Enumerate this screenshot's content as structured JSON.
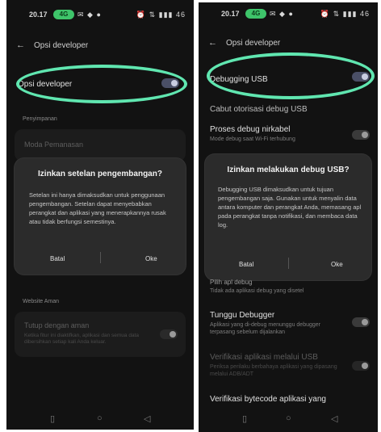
{
  "left": {
    "status": {
      "time": "20.17",
      "pill": "4G",
      "icons": "✉ ◆ ●",
      "sys": "⏰ ⇅ ▮▮▮ 46"
    },
    "appbar_title": "Opsi developer",
    "developer_option": "Opsi developer",
    "section_title": "Penyimpanan",
    "faded_row": "Moda Pemanasan",
    "dialog": {
      "title": "Izinkan setelan pengembangan?",
      "body": "Setelan ini hanya dimaksudkan untuk penggunaan pengembangan. Setelan dapat menyebabkan perangkat dan aplikasi yang menerapkannya rusak atau tidak berfungsi semestinya.",
      "cancel": "Batal",
      "ok": "Oke"
    },
    "lower_section": "Website Aman",
    "lower_row": {
      "label": "Tutup dengan aman",
      "sub": "Ketika fitur ini diaktifkan, aplikasi dan semua data dibersihkan setiap kali Anda keluar."
    },
    "nav": {
      "recent": "▯",
      "home": "○",
      "back": "◁"
    }
  },
  "right": {
    "status": {
      "time": "20.17",
      "pill": "4G",
      "icons": "✉ ◆ ●",
      "sys": "⏰ ⇅ ▮▮▮ 46"
    },
    "appbar_title": "Opsi developer",
    "usb_debugging": "Debugging USB",
    "row_revoke": "Cabut otorisasi debug USB",
    "row_wireless": {
      "label": "Proses debug nirkabel",
      "sub": "Mode debug saat Wi-Fi terhubung"
    },
    "dialog": {
      "title": "Izinkan melakukan debug USB?",
      "body": "Debugging USB dimaksudkan untuk tujuan pengembangan saja. Gunakan untuk menyalin data antara komputer dan perangkat Anda, memasang apl pada perangkat tanpa notifikasi, dan membaca data log.",
      "cancel": "Batal",
      "ok": "Oke"
    },
    "row_debug_app": {
      "label": "Pilih apl debug",
      "sub": "Tidak ada aplikasi debug yang disetel"
    },
    "row_wait_debugger": {
      "label": "Tunggu Debugger",
      "sub": "Aplikasi yang di-debug menunggu debugger terpasang sebelum dijalankan"
    },
    "row_verify_usb": {
      "label": "Verifikasi aplikasi melalui USB",
      "sub": "Periksa perilaku berbahaya aplikasi yang dipasang melalui ADB/ADT"
    },
    "row_bytecode": "Verifikasi bytecode aplikasi yang",
    "nav": {
      "recent": "▯",
      "home": "○",
      "back": "◁"
    }
  }
}
